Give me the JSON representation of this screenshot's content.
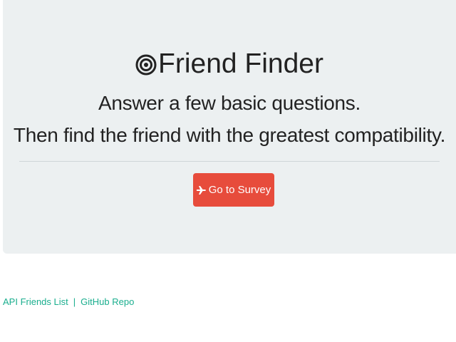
{
  "header": {
    "icon": "bullseye-icon",
    "title": "Friend Finder",
    "subtitle_line1": "Answer a few basic questions.",
    "subtitle_line2": "Then find the friend with the greatest compatibility."
  },
  "survey_button": {
    "icon": "plane-icon",
    "label": "Go to Survey",
    "color": "#e74c3c"
  },
  "footer": {
    "api_link": "API Friends List",
    "separator": "|",
    "github_link": "GitHub Repo",
    "link_color": "#1aae8e"
  },
  "colors": {
    "jumbotron_bg": "#ecf0f1"
  }
}
